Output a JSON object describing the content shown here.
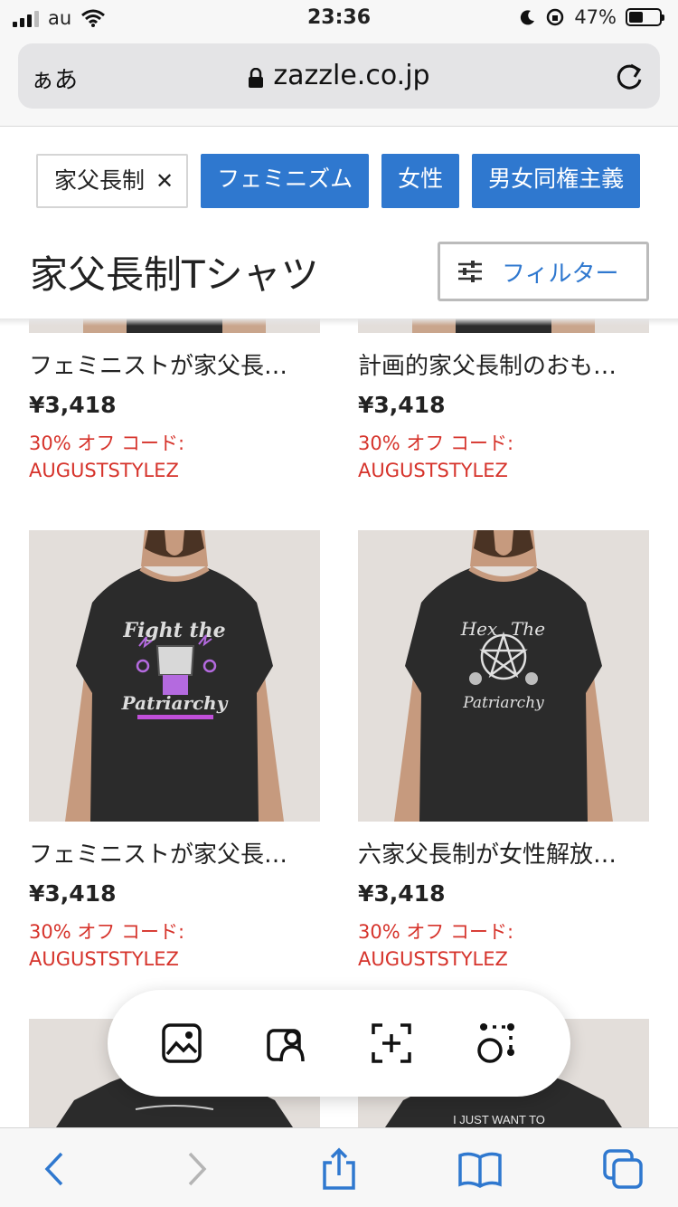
{
  "status_bar": {
    "carrier": "au",
    "time": "23:36",
    "battery": "47%",
    "battery_level": 0.47
  },
  "browser": {
    "aa_label": "ぁあ",
    "url": "zazzle.co.jp"
  },
  "tags": [
    {
      "label": "家父長制",
      "active": true
    },
    {
      "label": "フェミニズム",
      "active": false
    },
    {
      "label": "女性",
      "active": false
    },
    {
      "label": "男女同権主義",
      "active": false
    }
  ],
  "page": {
    "title": "家父長制Tシャツ",
    "filter_label": "フィルター"
  },
  "products": [
    {
      "title": "フェミニストが家父長…",
      "price": "¥3,418",
      "sale": "30% オフ コード:",
      "code": "AUGUSTSTYLEZ"
    },
    {
      "title": "計画的家父長制のおも…",
      "price": "¥3,418",
      "sale": "30% オフ コード:",
      "code": "AUGUSTSTYLEZ"
    },
    {
      "title": "フェミニストが家父長…",
      "price": "¥3,418",
      "sale": "30% オフ コード:",
      "code": "AUGUSTSTYLEZ",
      "print": [
        "Fight the",
        "Patriarchy"
      ]
    },
    {
      "title": "六家父長制が女性解放…",
      "price": "¥3,418",
      "sale": "30% オフ コード:",
      "code": "AUGUSTSTYLEZ",
      "print": [
        "Hex",
        "The",
        "Patriarchy"
      ]
    },
    {
      "print": [
        "I JUST WANT TO"
      ]
    }
  ],
  "colors": {
    "accent": "#2f78cf",
    "sale": "#d6332b",
    "shirt": "#2b2b2b",
    "image_bg": "#e3deda"
  },
  "icons": {
    "pill": [
      "image-icon",
      "portrait-icon",
      "add-frame-icon",
      "select-object-icon"
    ],
    "toolbar": [
      "back-icon",
      "forward-icon",
      "share-icon",
      "bookmarks-icon",
      "tabs-icon"
    ]
  }
}
